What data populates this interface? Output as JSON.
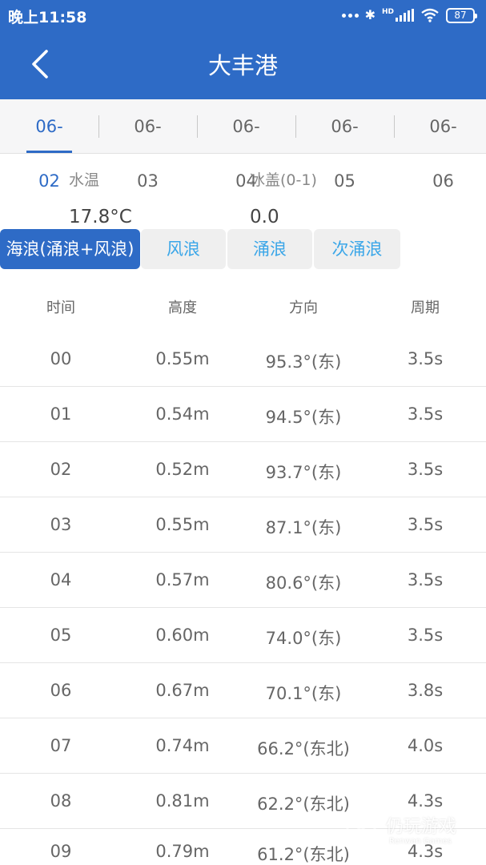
{
  "status": {
    "time": "晚上11:58",
    "network": "HD",
    "battery": "87"
  },
  "header": {
    "title": "大丰港"
  },
  "dates": [
    "06-02",
    "06-03",
    "06-04",
    "06-05",
    "06-06"
  ],
  "active_date": "06-02",
  "info": {
    "water_temp_label": "水温",
    "water_temp_value": "17.8°C",
    "ice_label": "冰盖(0-1)",
    "ice_value": "0.0"
  },
  "wave_tabs": [
    "海浪(涌浪+风浪)",
    "风浪",
    "涌浪",
    "次涌浪"
  ],
  "active_wave_tab": "海浪(涌浪+风浪)",
  "table": {
    "headers": [
      "时间",
      "高度",
      "方向",
      "周期"
    ],
    "rows": [
      [
        "00",
        "0.55m",
        "95.3°(东)",
        "3.5s"
      ],
      [
        "01",
        "0.54m",
        "94.5°(东)",
        "3.5s"
      ],
      [
        "02",
        "0.52m",
        "93.7°(东)",
        "3.5s"
      ],
      [
        "03",
        "0.55m",
        "87.1°(东)",
        "3.5s"
      ],
      [
        "04",
        "0.57m",
        "80.6°(东)",
        "3.5s"
      ],
      [
        "05",
        "0.60m",
        "74.0°(东)",
        "3.5s"
      ],
      [
        "06",
        "0.67m",
        "70.1°(东)",
        "3.8s"
      ],
      [
        "07",
        "0.74m",
        "66.2°(东北)",
        "4.0s"
      ],
      [
        "08",
        "0.81m",
        "62.2°(东北)",
        "4.3s"
      ],
      [
        "09",
        "0.79m",
        "61.2°(东北)",
        "4.3s"
      ]
    ]
  },
  "watermark": {
    "main": "仍玩游戏",
    "sub": "Renwan Games"
  },
  "colors": {
    "primary": "#2e6bc6",
    "tab_text": "#3aa6e8",
    "tab_bg": "#efefef"
  }
}
